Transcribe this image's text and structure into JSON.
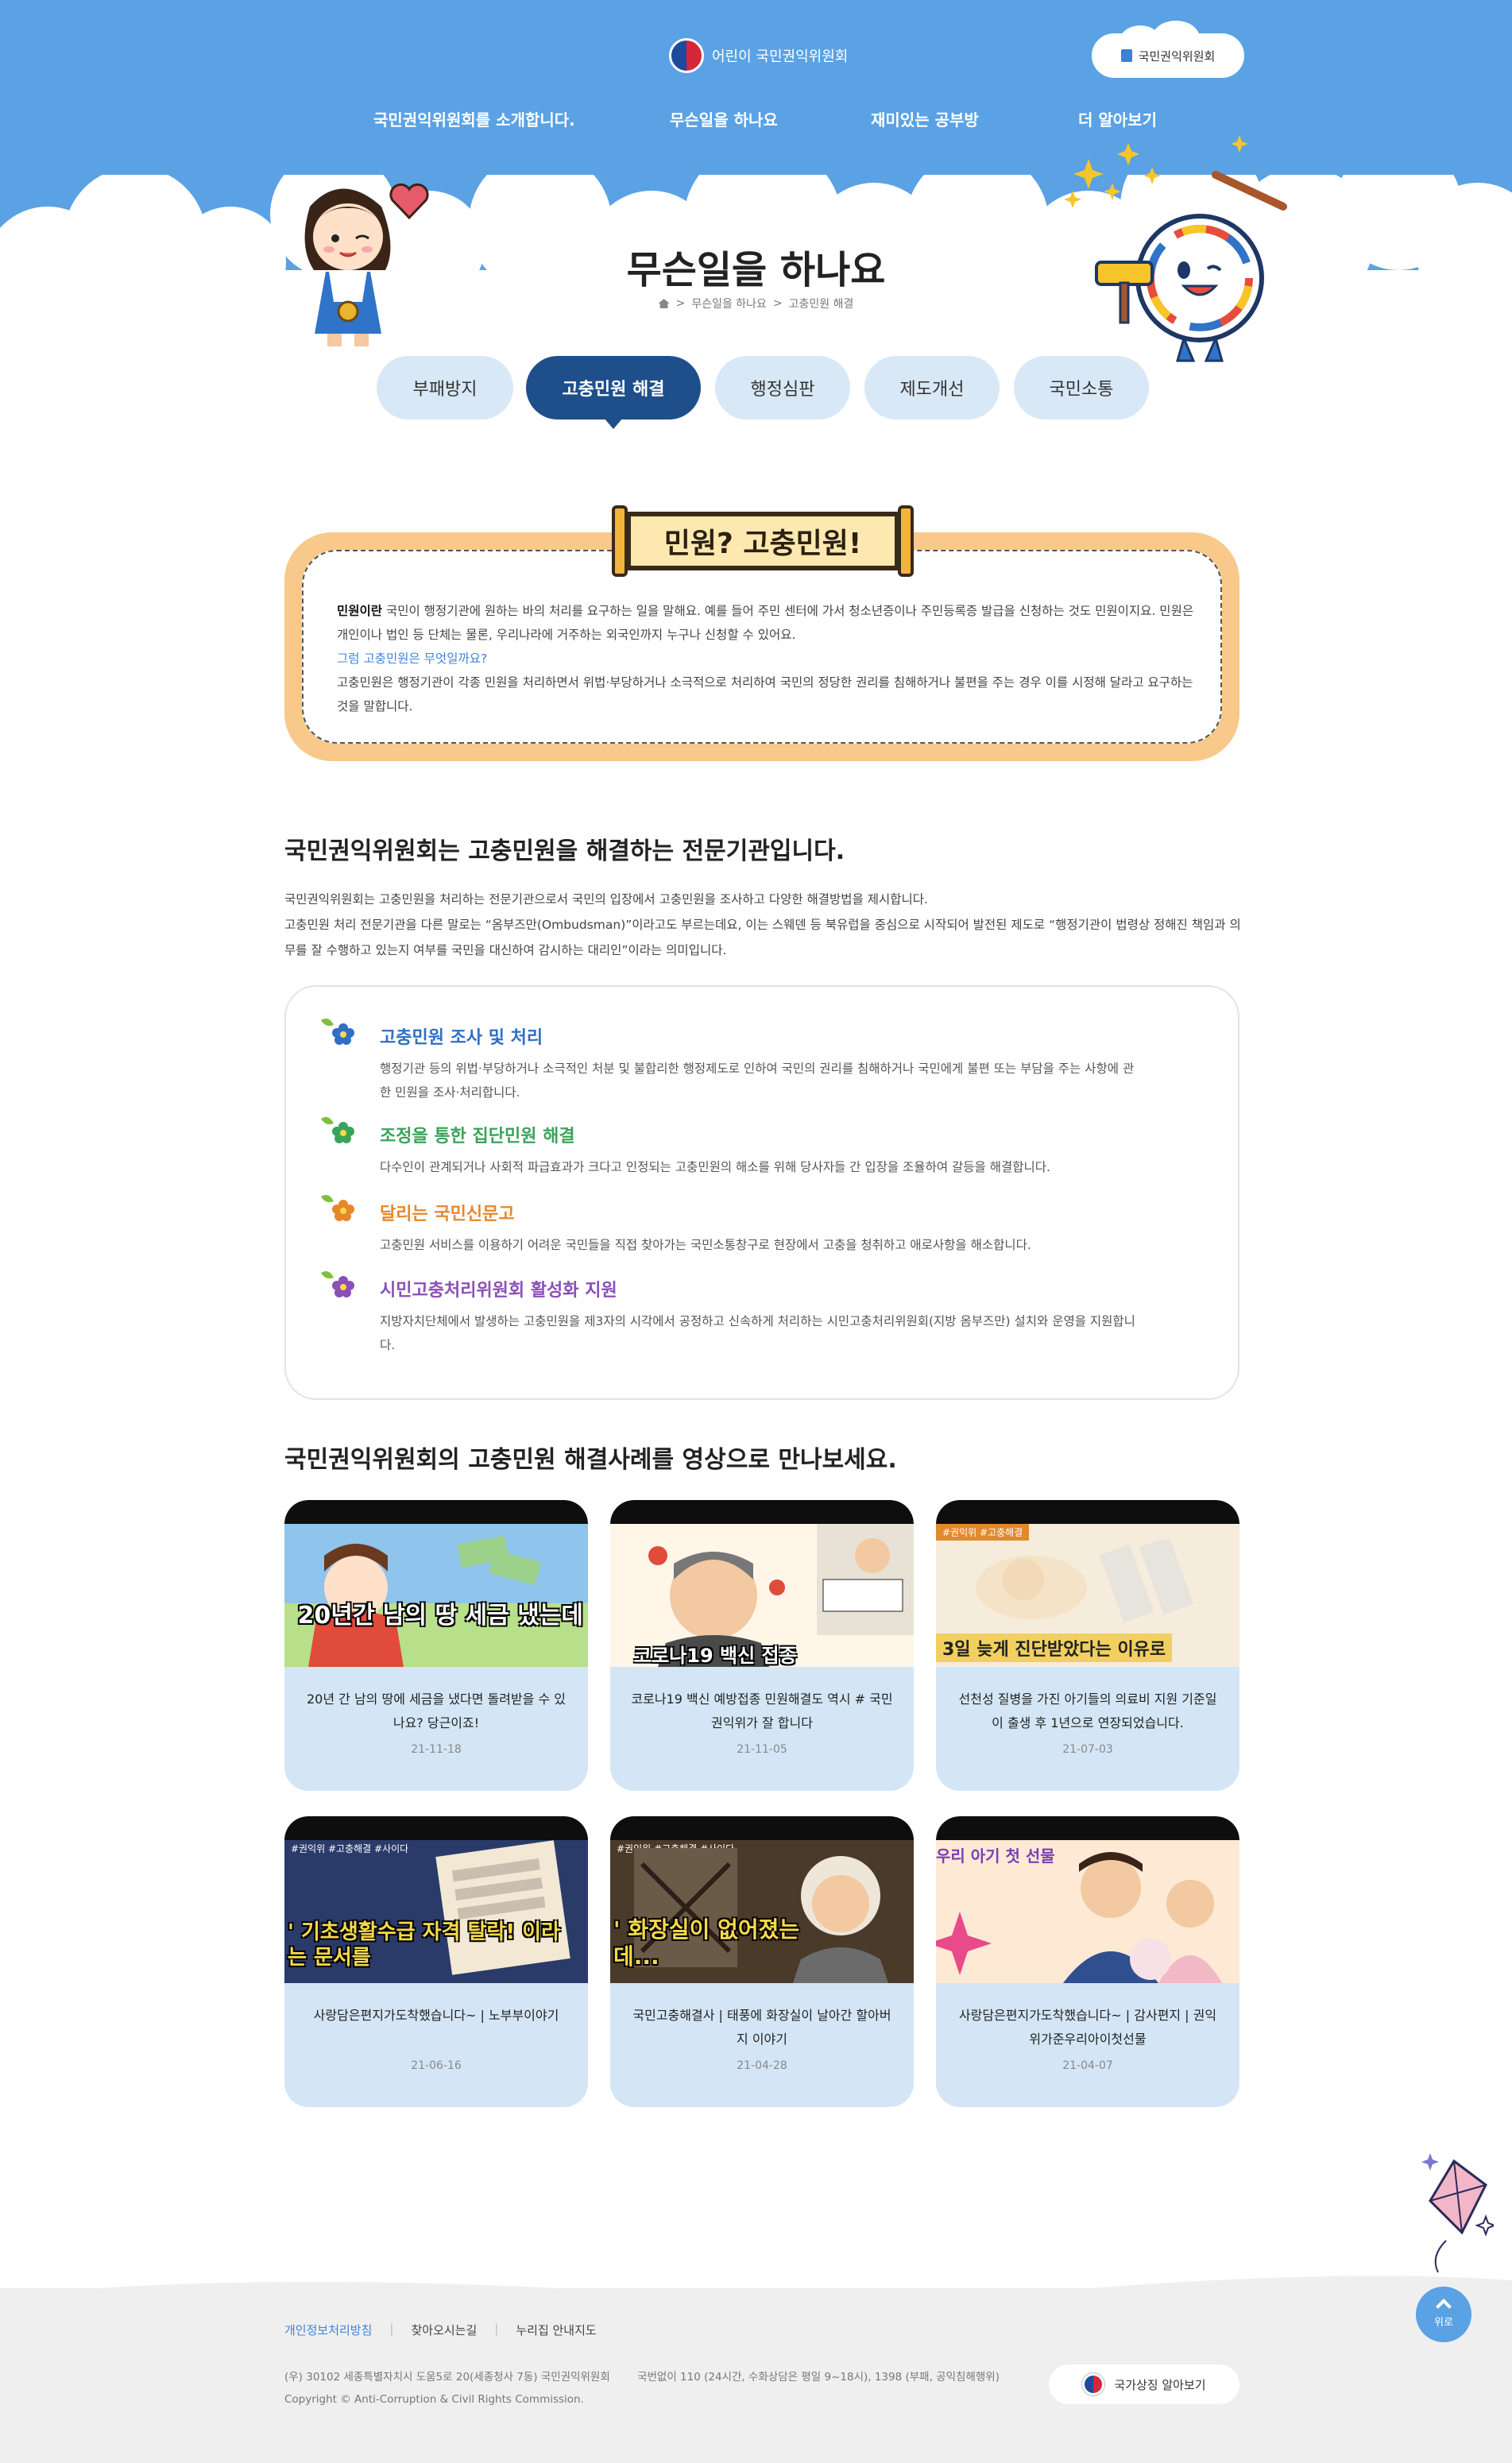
{
  "header": {
    "logo_text": "어린이 국민권익위원회",
    "top_button": "국민권익위원회",
    "nav": [
      {
        "label": "국민권익위원회를 소개합니다."
      },
      {
        "label": "무슨일을 하나요"
      },
      {
        "label": "재미있는 공부방"
      },
      {
        "label": "더 알아보기"
      }
    ],
    "page_title": "무슨일을 하나요",
    "breadcrumb": [
      "무슨일을 하나요",
      "고충민원 해결"
    ]
  },
  "tabs": [
    {
      "label": "부패방지",
      "active": false
    },
    {
      "label": "고충민원 해결",
      "active": true
    },
    {
      "label": "행정심판",
      "active": false
    },
    {
      "label": "제도개선",
      "active": false
    },
    {
      "label": "국민소통",
      "active": false
    }
  ],
  "definition": {
    "scroll_title": "민원? 고충민원!",
    "term": "민원이란",
    "line1": " 국민이 행정기관에 원하는 바의 처리를 요구하는 일을 말해요. 예를 들어 주민 센터에 가서 청소년증이나 주민등록증 발급을 신청하는 것도 민원이지요. 민원은 개인이나 법인 등 단체는 물론, 우리나라에 거주하는 외국인까지 누구나 신청할 수 있어요.",
    "question": "그럼 고충민원은 무엇일까요?",
    "line2": "고충민원은 행정기관이 각종 민원을 처리하면서 위법·부당하거나 소극적으로 처리하여 국민의 정당한 권리를 침해하거나 불편을 주는 경우 이를 시정해 달라고 요구하는 것을 말합니다."
  },
  "section1": {
    "title": "국민권익위원회는 고충민원을 해결하는 전문기관입니다.",
    "desc": [
      "국민권익위원회는 고충민원을 처리하는 전문기관으로서 국민의 입장에서 고충민원을 조사하고 다양한 해결방법을 제시합니다.",
      "고충민원 처리 전문기관을 다른 말로는 “옴부즈만(Ombudsman)”이라고도 부르는데요, 이는 스웨덴 등 북유럽을 중심으로 시작되어 발전된 제도로 “행정기관이 법령상 정해진 책임과 의무를 잘 수행하고 있는지 여부를 국민을 대신하여 감시하는 대리인”이라는 의미입니다."
    ],
    "features": [
      {
        "title": "고충민원 조사 및 처리",
        "color": "#2f6fc4",
        "icon": "blue-flower-icon",
        "body": "행정기관 등의 위법·부당하거나 소극적인 처분 및 불합리한 행정제도로 인하여 국민의 권리를 침해하거나 국민에게 불편 또는 부담을 주는 사항에 관한 민원을 조사·처리합니다."
      },
      {
        "title": "조정을 통한 집단민원 해결",
        "color": "#3aa35a",
        "icon": "green-flower-icon",
        "body": "다수인이 관계되거나 사회적 파급효과가 크다고 인정되는 고충민원의 해소를 위해 당사자들 간 입장을 조율하여 갈등을 해결합니다."
      },
      {
        "title": "달리는 국민신문고",
        "color": "#e8872a",
        "icon": "orange-flower-icon",
        "body": "고충민원 서비스를 이용하기 어려운 국민들을 직접 찾아가는 국민소통창구로 현장에서 고충을 청취하고 애로사항을 해소합니다."
      },
      {
        "title": "시민고충처리위원회 활성화 지원",
        "color": "#8a4fb8",
        "icon": "purple-flower-icon",
        "body": "지방자치단체에서 발생하는 고충민원을 제3자의 시각에서 공정하고 신속하게 처리하는 시민고충처리위원회(지방 옴부즈만) 설치와 운영을 지원합니다."
      }
    ]
  },
  "section2": {
    "title": "국민권익위원회의 고충민원 해결사례를 영상으로 만나보세요.",
    "videos": [
      {
        "title": "20년 간 남의 땅에 세금을 냈다면 돌려받을 수 있나요? 당근이죠!",
        "date": "21-11-18",
        "overlay": "20년간 남의 땅 세금 냈는데"
      },
      {
        "title": "코로나19 백신 예방접종 민원해결도 역시 # 국민권익위가 잘 합니다",
        "date": "21-11-05",
        "overlay": "코로나19 백신 접종"
      },
      {
        "title": "선천성 질병을 가진 아기들의 의료비 지원 기준일이 출생 후 1년으로 연장되었습니다.",
        "date": "21-07-03",
        "overlay": "3일 늦게 진단받았다는 이유로"
      },
      {
        "title": "사랑담은편지가도착했습니다~ | 노부부이야기",
        "date": "21-06-16",
        "overlay": "' 기초생활수급 자격 탈락! 이라는 문서를"
      },
      {
        "title": "국민고충해결사 | 태풍에 화장실이 날아간 할아버지 이야기",
        "date": "21-04-28",
        "overlay": "' 화장실이 없어졌는데..."
      },
      {
        "title": "사랑담은편지가도착했습니다~ | 감사편지 | 권익위가준우리아이첫선물",
        "date": "21-04-07",
        "overlay": "우리 아기 첫 선물"
      }
    ],
    "tags": [
      "#권익위 #고충해결 #사이다",
      "#권익위 #고충해결 #사이다",
      "#권익위 #고충해결"
    ]
  },
  "footer": {
    "links": [
      "개인정보처리방침",
      "찾아오시는길",
      "누리집 안내지도"
    ],
    "address": "(우) 30102 세종특별자치시 도움5로 20(세종청사 7동) 국민권익위원회",
    "phone": "국번없이 110 (24시간, 수화상담은 평일 9~18시), 1398 (부패, 공익침해행위)",
    "copyright": "Copyright © Anti-Corruption & Civil Rights Commission.",
    "button": "국가상징 알아보기",
    "top_label": "위로"
  },
  "colors": {
    "sky": "#5aa2e4",
    "navy": "#1e4f8a",
    "tab": "#d8e8f6",
    "orange_frame": "#f8c98a",
    "card": "#d4e6f6"
  }
}
